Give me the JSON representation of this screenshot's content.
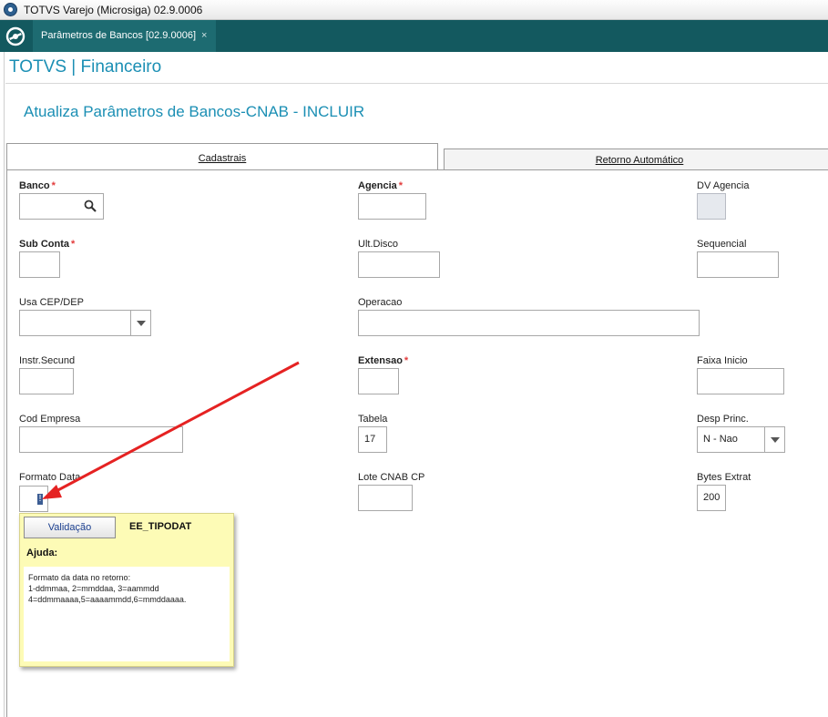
{
  "window": {
    "title": "TOTVS Varejo (Microsiga) 02.9.0006"
  },
  "tabbar": {
    "active_tab": "Parâmetros de Bancos [02.9.0006]",
    "close_glyph": "×"
  },
  "module_title": "TOTVS | Financeiro",
  "page_title": "Atualiza Parâmetros de Bancos-CNAB - INCLUIR",
  "folders": {
    "cadastrais": "Cadastrais",
    "retorno": "Retorno Automático"
  },
  "required_mark": "*",
  "fields": {
    "banco": {
      "label": "Banco",
      "value": ""
    },
    "agencia": {
      "label": "Agencia",
      "value": ""
    },
    "dv_agencia": {
      "label": "DV Agencia",
      "value": ""
    },
    "sub_conta": {
      "label": "Sub Conta",
      "value": ""
    },
    "ult_disco": {
      "label": "Ult.Disco",
      "value": ""
    },
    "sequencial": {
      "label": "Sequencial",
      "value": ""
    },
    "usa_cep_dep": {
      "label": "Usa CEP/DEP",
      "value": ""
    },
    "operacao": {
      "label": "Operacao",
      "value": ""
    },
    "instr_secund": {
      "label": "Instr.Secund",
      "value": ""
    },
    "extensao": {
      "label": "Extensao",
      "value": ""
    },
    "faixa_inicio": {
      "label": "Faixa Inicio",
      "value": ""
    },
    "cod_empresa": {
      "label": "Cod Empresa",
      "value": ""
    },
    "tabela": {
      "label": "Tabela",
      "value": "17"
    },
    "desp_princ": {
      "label": "Desp Princ.",
      "value": "N - Nao"
    },
    "formato_data": {
      "label": "Formato Data",
      "value": "!"
    },
    "lote_cnab_cp": {
      "label": "Lote CNAB CP",
      "value": ""
    },
    "bytes_extrat": {
      "label": "Bytes Extrat",
      "value": "200"
    }
  },
  "help": {
    "validacao_button": "Validação",
    "field_name": "EE_TIPODAT",
    "ajuda_label": "Ajuda:",
    "lines": [
      "Formato da data no retorno:",
      "1-ddmmaa, 2=mmddaa, 3=aammdd",
      "4=ddmmaaaa,5=aaaammdd,6=mmddaaaa."
    ]
  },
  "colors": {
    "tabbar": "#13595f",
    "title_blue": "#1b8fb4",
    "required": "#e23b3b",
    "tooltip": "#fdfbb6",
    "annotation_arrow": "#e52222"
  },
  "icons": {
    "app": "totvs-app-icon",
    "home": "totvs-home-icon",
    "lookup": "search-icon",
    "dropdown": "chevron-down-icon"
  }
}
